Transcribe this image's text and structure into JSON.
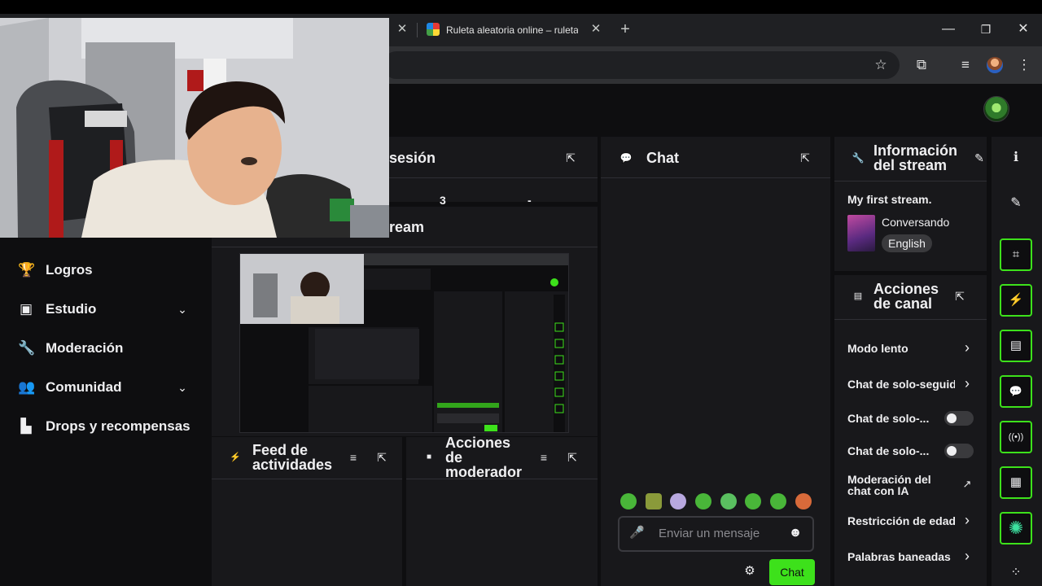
{
  "browser": {
    "tab_title": "Ruleta aleatoria online – ruleta",
    "tab_close_glyph": "✕",
    "new_tab_glyph": "+",
    "window": {
      "minimize": "—",
      "maximize": "❐",
      "close": "✕"
    },
    "toolbar_icons": {
      "bookmark": "☆",
      "extensions": "⧉",
      "media": "≡"
    }
  },
  "nav": {
    "items": [
      {
        "label": "Logros",
        "icon": "trophy-icon",
        "glyph": "🏆",
        "expandable": false
      },
      {
        "label": "Estudio",
        "icon": "studio-icon",
        "glyph": "▣",
        "expandable": true
      },
      {
        "label": "Moderación",
        "icon": "wrench-icon",
        "glyph": "🔧",
        "expandable": false
      },
      {
        "label": "Comunidad",
        "icon": "community-icon",
        "glyph": "👥",
        "expandable": true
      },
      {
        "label": "Drops y recompensas",
        "icon": "drops-icon",
        "glyph": "▙",
        "expandable": false
      }
    ],
    "chevron_glyph": "⌄"
  },
  "panels": {
    "session": {
      "title": "sesión",
      "value_a": "3",
      "value_b": "-"
    },
    "stream_preview": {
      "title": "ream"
    },
    "activity_feed": {
      "title_line1": "Feed de",
      "title_line2": "actividades"
    },
    "mod_actions": {
      "title_line1": "Acciones",
      "title_line2": "de",
      "title_line3": "moderador"
    },
    "chat": {
      "title": "Chat",
      "input_placeholder": "Enviar un mensaje",
      "send_label": "Chat"
    },
    "stream_info": {
      "title_line1": "Información",
      "title_line2": "del stream",
      "stream_title": "My first stream.",
      "category": "Conversando",
      "language_tag": "English"
    },
    "channel_actions": {
      "title_line1": "Acciones",
      "title_line2": "de canal",
      "rows": [
        {
          "label": "Modo lento",
          "control": "chevron"
        },
        {
          "label": "Chat de solo-seguidores",
          "control": "chevron"
        },
        {
          "label": "Chat de solo-...",
          "control": "toggle",
          "on": false
        },
        {
          "label": "Chat de solo-...",
          "control": "toggle",
          "on": false
        },
        {
          "label_line1": "Moderación del",
          "label_line2": "chat con IA",
          "control": "external"
        },
        {
          "label": "Restricción de edad",
          "control": "chevron"
        },
        {
          "label": "Palabras baneadas",
          "control": "chevron"
        }
      ]
    }
  },
  "glyphs": {
    "popout": "⇱",
    "filter": "≡",
    "chat": "💬",
    "wrench": "🔧",
    "pencil": "✎",
    "info": "ℹ",
    "emote_button": "☻",
    "mic": "🎤",
    "gear": "⚙",
    "chevron_right": "›"
  },
  "rail": [
    {
      "name": "info-icon",
      "glyph": "ℹ",
      "boxed": false
    },
    {
      "name": "pencil-icon",
      "glyph": "✎",
      "boxed": false
    },
    {
      "name": "clip-icon",
      "glyph": "⌗",
      "boxed": true
    },
    {
      "name": "lightning-icon",
      "glyph": "⚡",
      "boxed": true
    },
    {
      "name": "notes-icon",
      "glyph": "▤",
      "boxed": true
    },
    {
      "name": "chat-bubble-icon",
      "glyph": "💬",
      "boxed": true
    },
    {
      "name": "broadcast-icon",
      "glyph": "((•))",
      "boxed": true
    },
    {
      "name": "video-icon",
      "glyph": "▦",
      "boxed": true
    },
    {
      "name": "openai-icon",
      "glyph": "✺",
      "boxed": true
    },
    {
      "name": "more-icon",
      "glyph": "⁘",
      "boxed": false
    }
  ],
  "colors": {
    "accent_green": "#3de11b",
    "panel_bg": "#18181b",
    "page_bg": "#0e0e10",
    "browser_tab_bg": "#1f2023",
    "browser_toolbar_bg": "#303134"
  }
}
